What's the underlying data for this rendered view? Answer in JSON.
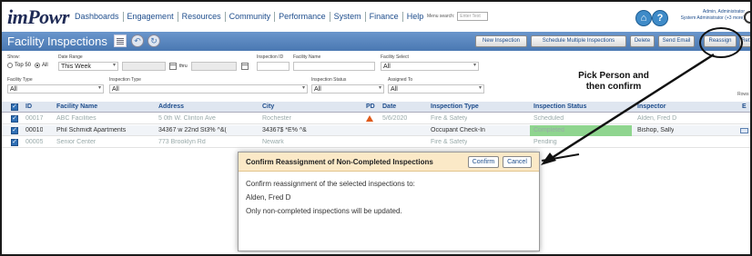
{
  "app": {
    "logo": "imPowr"
  },
  "nav": [
    "Dashboards",
    "Engagement",
    "Resources",
    "Community",
    "Performance",
    "System",
    "Finance",
    "Help"
  ],
  "menu_search": {
    "label": "Menu search:",
    "placeholder": "Enter Text"
  },
  "admin": {
    "name": "Admin, Administrator",
    "role": "System Administrator (+3 more)"
  },
  "page": {
    "title": "Facility Inspections",
    "buttons": [
      "New Inspection",
      "Schedule Multiple Inspections",
      "Delete",
      "Send Email",
      "Reassign",
      "Ret"
    ]
  },
  "filters": {
    "show_label": "Show:",
    "top50": "Top 50",
    "all": "All",
    "date_range_label": "Date Range",
    "date_range": "This Week",
    "thru": "thru",
    "inspection_id_label": "Inspection ID",
    "facility_name_label": "Facility Name",
    "facility_select_label": "Facility Select",
    "facility_select": "All",
    "facility_type_label": "Facility Type",
    "facility_type": "All",
    "inspection_type_label": "Inspection Type",
    "inspection_type": "All",
    "inspection_status_label": "Inspection Status",
    "inspection_status": "All",
    "assigned_to_label": "Assigned To",
    "assigned_to": "All",
    "rows_label": "Rows"
  },
  "table": {
    "columns": [
      "ID",
      "Facility Name",
      "Address",
      "City",
      "PD",
      "Date",
      "Inspection Type",
      "Inspection Status",
      "Inspector",
      "E"
    ],
    "rows": [
      {
        "id": "00017",
        "facility": "ABC Facilities",
        "address": "5 0th W. Clinton Ave",
        "city": "Rochester",
        "pd": "",
        "date": "5/6/2020",
        "type": "Fire & Safety",
        "status": "Scheduled",
        "inspector": "Alden, Fred D"
      },
      {
        "id": "00010",
        "facility": "Phil Schmidt Apartments",
        "address": "34367 w 22nd St3% ^&( ",
        "city": "34367$ *E% ^&",
        "pd": "",
        "date": "",
        "type": "Occupant Check-In",
        "status": "Completed",
        "inspector": "Bishop, Sally"
      },
      {
        "id": "00005",
        "facility": "Senior Center",
        "address": "773 Brooklyn Rd",
        "city": "Newark",
        "pd": "",
        "date": "",
        "type": "Fire & Safety",
        "status": "Pending",
        "inspector": ""
      }
    ]
  },
  "annotation": {
    "line1": "Pick Person and",
    "line2": "then confirm"
  },
  "dialog": {
    "title": "Confirm Reassignment of Non-Completed Inspections",
    "confirm": "Confirm",
    "cancel": "Cancel",
    "line1": "Confirm reassignment of the selected inspections to:",
    "line2": "Alden, Fred D",
    "line3": "Only non-completed inspections will be updated."
  }
}
